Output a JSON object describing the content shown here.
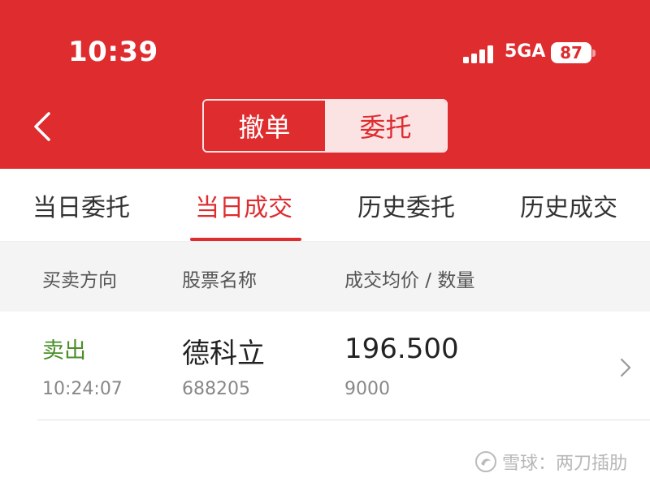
{
  "status_bar": {
    "time": "10:39",
    "network": "5GA",
    "battery": "87"
  },
  "header": {
    "back_icon": "chevron-left-icon",
    "segments": [
      "撤单",
      "委托"
    ],
    "active_segment": "委托"
  },
  "tabs": {
    "items": [
      "当日委托",
      "当日成交",
      "历史委托",
      "历史成交"
    ],
    "active": "当日成交"
  },
  "columns": {
    "direction": "买卖方向",
    "stock": "股票名称",
    "price_qty": "成交均价 / 数量"
  },
  "rows": [
    {
      "direction": "卖出",
      "time": "10:24:07",
      "stock_name": "德科立",
      "stock_code": "688205",
      "price": "196.500",
      "quantity": "9000"
    }
  ],
  "watermark": {
    "logo": "snowball-logo",
    "text": "雪球：两刀插肋"
  },
  "colors": {
    "primary_red": "#de2c2f",
    "sell_green": "#4a8f2a",
    "segment_light": "#fbe3e3"
  }
}
